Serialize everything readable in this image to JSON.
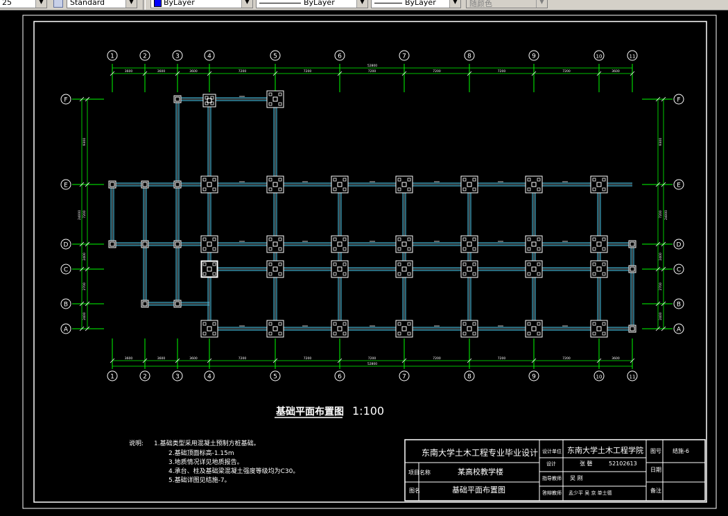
{
  "toolbar": {
    "scale_value": "25",
    "text_style": "Standard",
    "layer_color": "ByLayer",
    "linetype": "ByLayer",
    "lineweight": "ByLayer",
    "plot_style": "随颜色"
  },
  "colors": {
    "background": "#000000",
    "frame": "#ffffff",
    "grid_axis": "#00ff00",
    "beam": "#3fa9c8",
    "column": "#ffffff"
  },
  "drawing": {
    "col_axes": [
      "1",
      "2",
      "3",
      "4",
      "5",
      "6",
      "7",
      "8",
      "9",
      "10",
      "11"
    ],
    "row_axes": [
      "F",
      "E",
      "D",
      "C",
      "B",
      "A"
    ],
    "overall_dim": "52800",
    "top_dims": [
      "3600",
      "3600",
      "3600",
      "7200",
      "7200",
      "7200",
      "7200",
      "7200",
      "7200",
      "3600"
    ],
    "bottom_dims": [
      "3600",
      "3600",
      "3600",
      "7200",
      "7200",
      "7200",
      "7200",
      "7200",
      "7200",
      "3600"
    ],
    "left_dims": [
      "9300",
      "7200",
      "2400",
      "2700",
      "2400"
    ],
    "left_overall": "24000",
    "title": "基础平面布置图",
    "scale": "1:100"
  },
  "notes": {
    "heading": "说明:",
    "lines": [
      "1.基础类型采用混凝土预制方桩基础。",
      "2.基础顶面标高-1.15m",
      "3.地质情况详见地质报告。",
      "4.承台、柱及基础梁混凝土强度等级均为C30。",
      "5.基础详图见结施-7。"
    ]
  },
  "title_block": {
    "university": "东南大学土木工程专业毕业设计",
    "project_label": "项目名称",
    "project_name": "某高校教学楼",
    "drawing_label": "图名",
    "drawing_name": "基础平面布置图",
    "design_unit_label": "设计单位",
    "design_unit": "东南大学土木工程学院",
    "designer_label": "设计",
    "designer_name": "张 磬",
    "student_id": "52102613",
    "instructor_label": "指导教师",
    "instructor_name": "吴 刚",
    "teachers_label": "答辩教师",
    "teachers_names": "孟少平 吴 京 单士德",
    "sheet_no_label": "图号",
    "sheet_no": "结施-6",
    "date_label": "日期",
    "note_label": "备注"
  }
}
